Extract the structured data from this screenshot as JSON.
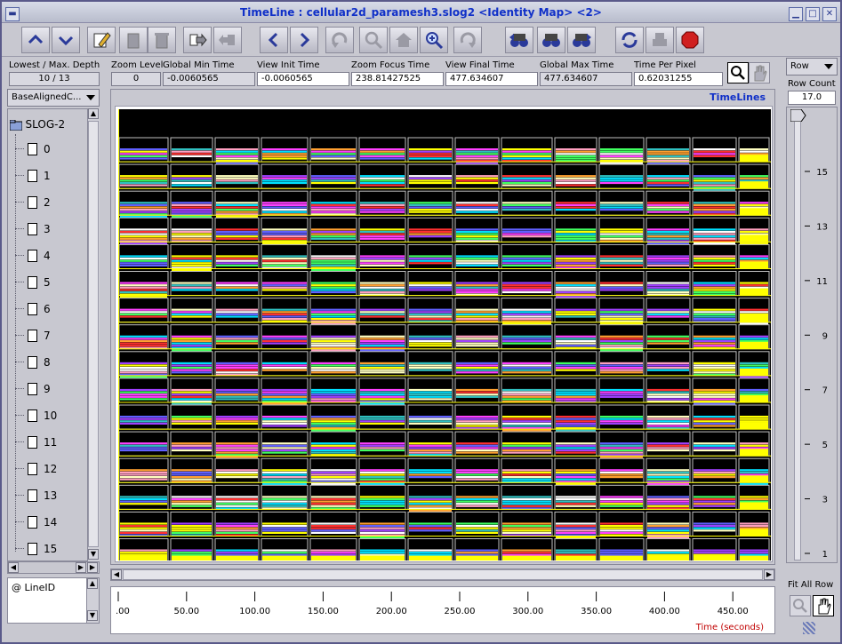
{
  "window": {
    "title": "TimeLine : cellular2d_paramesh3.slog2  <Identity Map> <2>",
    "menu_icon": "window-menu-icon",
    "buttons": [
      "minimize-icon",
      "maximize-icon",
      "close-icon"
    ]
  },
  "toolbar": {
    "buttons": [
      {
        "name": "scroll-up-button",
        "icon": "chevron-up-icon"
      },
      {
        "name": "scroll-down-button",
        "icon": "chevron-down-icon"
      },
      {
        "name": "edit-button",
        "icon": "pencil-icon"
      },
      {
        "name": "clipboard-button",
        "icon": "clipboard-icon"
      },
      {
        "name": "delete-button",
        "icon": "trash-icon"
      },
      {
        "name": "redo-move-button",
        "icon": "arrow-right-icon"
      },
      {
        "name": "undo-move-button",
        "icon": "arrow-left-block-icon"
      },
      {
        "name": "scroll-left-button",
        "icon": "chevron-left-icon"
      },
      {
        "name": "scroll-right-button",
        "icon": "chevron-right-icon"
      },
      {
        "name": "undo-zoom-button",
        "icon": "undo-arrow-icon"
      },
      {
        "name": "zoom-out-button",
        "icon": "zoom-out-icon"
      },
      {
        "name": "home-button",
        "icon": "home-icon"
      },
      {
        "name": "zoom-in-button",
        "icon": "zoom-in-icon"
      },
      {
        "name": "redo-zoom-button",
        "icon": "redo-arrow-icon"
      },
      {
        "name": "search-backward-button",
        "icon": "binoculars-left-icon"
      },
      {
        "name": "search-init-button",
        "icon": "binoculars-icon"
      },
      {
        "name": "search-forward-button",
        "icon": "binoculars-right-icon"
      },
      {
        "name": "refresh-button",
        "icon": "refresh-icon"
      },
      {
        "name": "print-button",
        "icon": "printer-icon"
      },
      {
        "name": "stop-button",
        "icon": "stop-sign-icon"
      }
    ]
  },
  "info": {
    "depth_label": "Lowest / Max. Depth",
    "depth_value": "10 / 13",
    "zoom_level_label": "Zoom Level",
    "zoom_level_value": "0",
    "global_min_label": "Global Min Time",
    "global_min_value": "-0.0060565",
    "view_init_label": "View  Init Time",
    "view_init_value": "-0.0060565",
    "zoom_focus_label": "Zoom Focus Time",
    "zoom_focus_value": "238.81427525",
    "view_final_label": "View Final Time",
    "view_final_value": "477.634607",
    "global_max_label": "Global Max Time",
    "global_max_value": "477.634607",
    "time_per_pixel_label": "Time Per Pixel",
    "time_per_pixel_value": "0.62031255"
  },
  "left_panel": {
    "map_combo": "BaseAlignedC...",
    "root_label": "SLOG-2",
    "rows": [
      "0",
      "1",
      "2",
      "3",
      "4",
      "5",
      "6",
      "7",
      "8",
      "9",
      "10",
      "11",
      "12",
      "13",
      "14",
      "15"
    ],
    "line_id_label": "@ LineID"
  },
  "timelines_label": "TimeLines",
  "axis": {
    "ticks": [
      ".00",
      "50.00",
      "100.00",
      "150.00",
      "200.00",
      "250.00",
      "300.00",
      "350.00",
      "400.00",
      "450.00"
    ],
    "label": "Time (seconds)"
  },
  "right_panel": {
    "row_combo": "Row",
    "row_count_label": "Row Count",
    "row_count_value": "17.0",
    "slider_ticks": [
      "15",
      "13",
      "11",
      "9",
      "7",
      "5",
      "3",
      "1"
    ],
    "fit_all_label": "Fit All Row"
  },
  "colors": {
    "title": "#1030c8",
    "axis_label": "#c00000",
    "timelines_label": "#1030c8",
    "canvas_bg": "#000000"
  }
}
